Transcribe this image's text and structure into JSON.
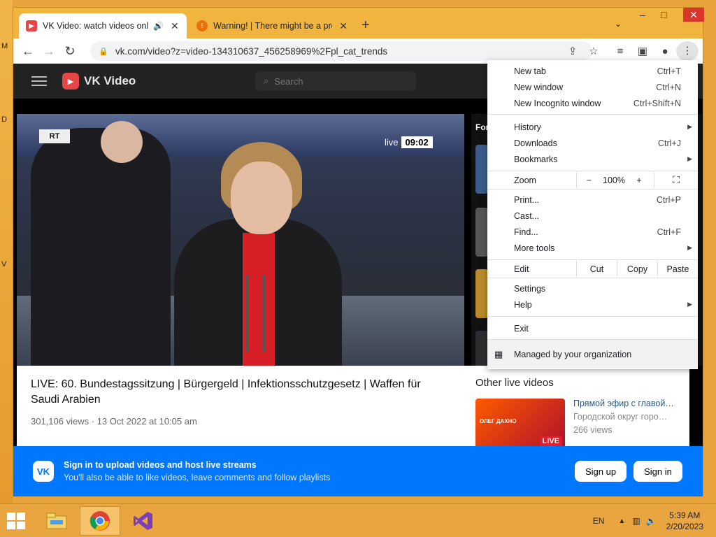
{
  "desktop": {
    "edge_letters": [
      "M",
      "D",
      "V"
    ]
  },
  "browser": {
    "tabs": [
      {
        "title": "VK Video: watch videos online",
        "audio_icon": "speaker-icon"
      },
      {
        "title": "Warning! | There might be a problem"
      }
    ],
    "window_controls": {
      "minimize": "–",
      "maximize": "□",
      "close": "✕"
    },
    "url": "vk.com/video?z=video-134310637_456258969%2Fpl_cat_trends",
    "toolbar_icons": [
      "share-icon",
      "star-icon",
      "media-icon",
      "sidepanel-icon",
      "profile-icon",
      "more-icon"
    ]
  },
  "vk": {
    "brand": "VK Video",
    "search_placeholder": "Search",
    "video": {
      "channel_logo": "RT",
      "live_label": "live",
      "live_time": "09:02"
    },
    "side_heading": "For",
    "title": "LIVE: 60. Bundestagssitzung | Bürgergeld | Infektionsschutzgesetz | Waffen für Saudi Arabien",
    "views": "301,106 views",
    "date": "13 Oct 2022 at 10:05 am",
    "other_heading": "Other live videos",
    "other": [
      {
        "title": "Прямой эфир с главой…",
        "author": "Городской округ горо…",
        "views": "266 views",
        "thumb_text": "ОЛЕГ ДАХНО",
        "badge": "LIVE"
      }
    ],
    "banner": {
      "title": "Sign in to upload videos and host live streams",
      "subtitle": "You'll also be able to like videos, leave comments and follow playlists",
      "signup": "Sign up",
      "signin": "Sign in"
    }
  },
  "menu": {
    "new_tab": {
      "label": "New tab",
      "shortcut": "Ctrl+T"
    },
    "new_window": {
      "label": "New window",
      "shortcut": "Ctrl+N"
    },
    "incognito": {
      "label": "New Incognito window",
      "shortcut": "Ctrl+Shift+N"
    },
    "history": {
      "label": "History"
    },
    "downloads": {
      "label": "Downloads",
      "shortcut": "Ctrl+J"
    },
    "bookmarks": {
      "label": "Bookmarks"
    },
    "zoom": {
      "label": "Zoom",
      "minus": "−",
      "value": "100%",
      "plus": "+"
    },
    "print": {
      "label": "Print...",
      "shortcut": "Ctrl+P"
    },
    "cast": {
      "label": "Cast..."
    },
    "find": {
      "label": "Find...",
      "shortcut": "Ctrl+F"
    },
    "more_tools": {
      "label": "More tools"
    },
    "edit": {
      "label": "Edit",
      "cut": "Cut",
      "copy": "Copy",
      "paste": "Paste"
    },
    "settings": {
      "label": "Settings"
    },
    "help": {
      "label": "Help"
    },
    "exit": {
      "label": "Exit"
    },
    "managed": {
      "label": "Managed by your organization"
    }
  },
  "taskbar": {
    "apps": [
      "file-explorer-icon",
      "chrome-icon",
      "visual-studio-icon"
    ],
    "lang": "EN",
    "time": "5:39 AM",
    "date": "2/20/2023"
  }
}
